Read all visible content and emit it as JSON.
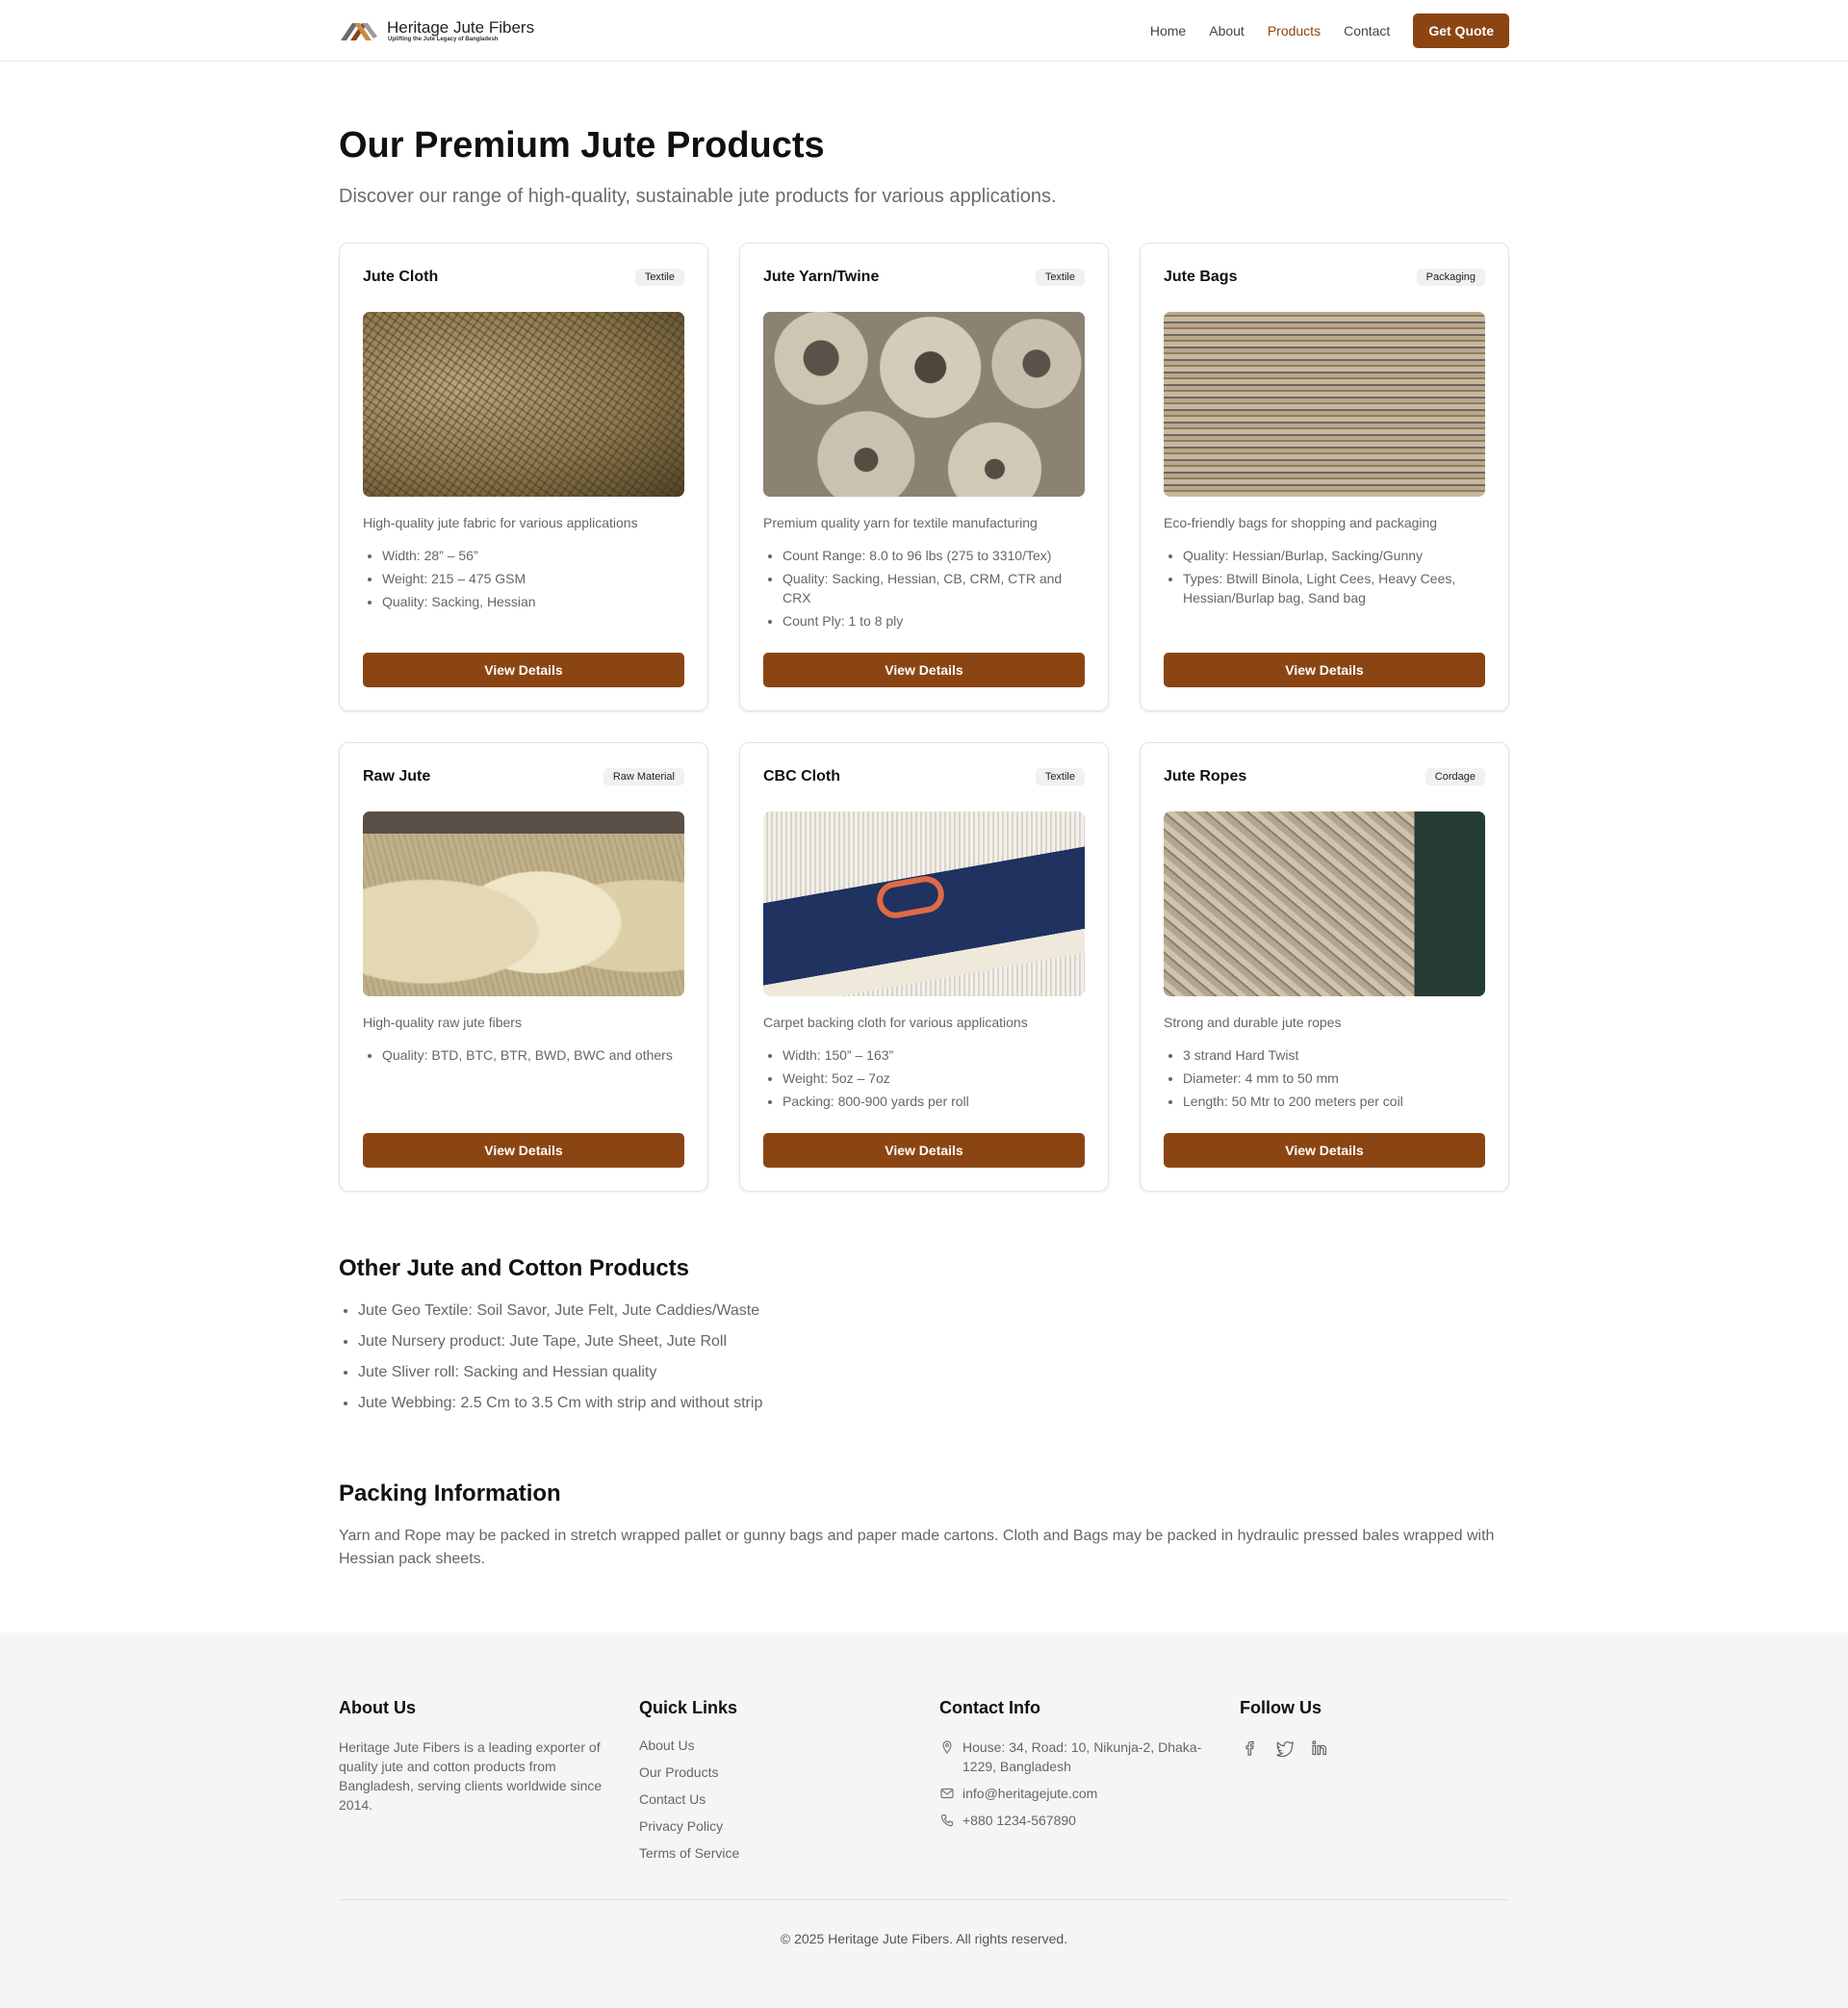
{
  "brand": {
    "name": "Heritage Jute Fibers",
    "tagline": "Uplifting the Jute Legacy of Bangladesh"
  },
  "nav": {
    "items": [
      "Home",
      "About",
      "Products",
      "Contact"
    ],
    "active": "Products",
    "cta": "Get Quote"
  },
  "hero": {
    "title": "Our Premium Jute Products",
    "subtitle": "Discover our range of high-quality, sustainable jute products for various applications."
  },
  "colors": {
    "accent": "#8b4513"
  },
  "products": [
    {
      "name": "Jute Cloth",
      "category": "Textile",
      "image": "jute-cloth-photo",
      "description": "High-quality jute fabric for various applications",
      "specs": [
        "Width: 28” – 56”",
        "Weight: 215 – 475 GSM",
        "Quality: Sacking, Hessian"
      ],
      "button": "View Details"
    },
    {
      "name": "Jute Yarn/Twine",
      "category": "Textile",
      "image": "jute-yarn-photo",
      "description": "Premium quality yarn for textile manufacturing",
      "specs": [
        "Count Range: 8.0 to 96 lbs (275 to 3310/Tex)",
        "Quality: Sacking, Hessian, CB, CRM, CTR and CRX",
        "Count Ply: 1 to 8 ply"
      ],
      "button": "View Details"
    },
    {
      "name": "Jute Bags",
      "category": "Packaging",
      "image": "jute-bags-photo",
      "description": "Eco-friendly bags for shopping and packaging",
      "specs": [
        "Quality: Hessian/Burlap, Sacking/Gunny",
        "Types: Btwill Binola, Light Cees, Heavy Cees, Hessian/Burlap bag, Sand bag"
      ],
      "button": "View Details"
    },
    {
      "name": "Raw Jute",
      "category": "Raw Material",
      "image": "raw-jute-photo",
      "description": "High-quality raw jute fibers",
      "specs": [
        "Quality: BTD, BTC, BTR, BWD, BWC and others"
      ],
      "button": "View Details"
    },
    {
      "name": "CBC Cloth",
      "category": "Textile",
      "image": "cbc-cloth-photo",
      "description": "Carpet backing cloth for various applications",
      "specs": [
        "Width: 150” – 163”",
        "Weight: 5oz – 7oz",
        "Packing: 800-900 yards per roll"
      ],
      "button": "View Details"
    },
    {
      "name": "Jute Ropes",
      "category": "Cordage",
      "image": "jute-ropes-photo",
      "description": "Strong and durable jute ropes",
      "specs": [
        "3 strand Hard Twist",
        "Diameter: 4 mm to 50 mm",
        "Length: 50 Mtr to 200 meters per coil"
      ],
      "button": "View Details"
    }
  ],
  "other_products": {
    "title": "Other Jute and Cotton Products",
    "items": [
      "Jute Geo Textile: Soil Savor, Jute Felt, Jute Caddies/Waste",
      "Jute Nursery product: Jute Tape, Jute Sheet, Jute Roll",
      "Jute Sliver roll: Sacking and Hessian quality",
      "Jute Webbing: 2.5 Cm to 3.5 Cm with strip and without strip"
    ]
  },
  "packing": {
    "title": "Packing Information",
    "text": "Yarn and Rope may be packed in stretch wrapped pallet or gunny bags and paper made cartons. Cloth and Bags may be packed in hydraulic pressed bales wrapped with Hessian pack sheets."
  },
  "footer": {
    "about": {
      "heading": "About Us",
      "text": "Heritage Jute Fibers is a leading exporter of quality jute and cotton products from Bangladesh, serving clients worldwide since 2014."
    },
    "quick_links": {
      "heading": "Quick Links",
      "items": [
        "About Us",
        "Our Products",
        "Contact Us",
        "Privacy Policy",
        "Terms of Service"
      ]
    },
    "contact": {
      "heading": "Contact Info",
      "address": "House: 34, Road: 10, Nikunja-2, Dhaka-1229, Bangladesh",
      "email": "info@heritagejute.com",
      "phone": "+880 1234-567890"
    },
    "follow": {
      "heading": "Follow Us",
      "icons": [
        "facebook-icon",
        "twitter-icon",
        "linkedin-icon"
      ]
    },
    "copyright": "© 2025 Heritage Jute Fibers. All rights reserved."
  }
}
